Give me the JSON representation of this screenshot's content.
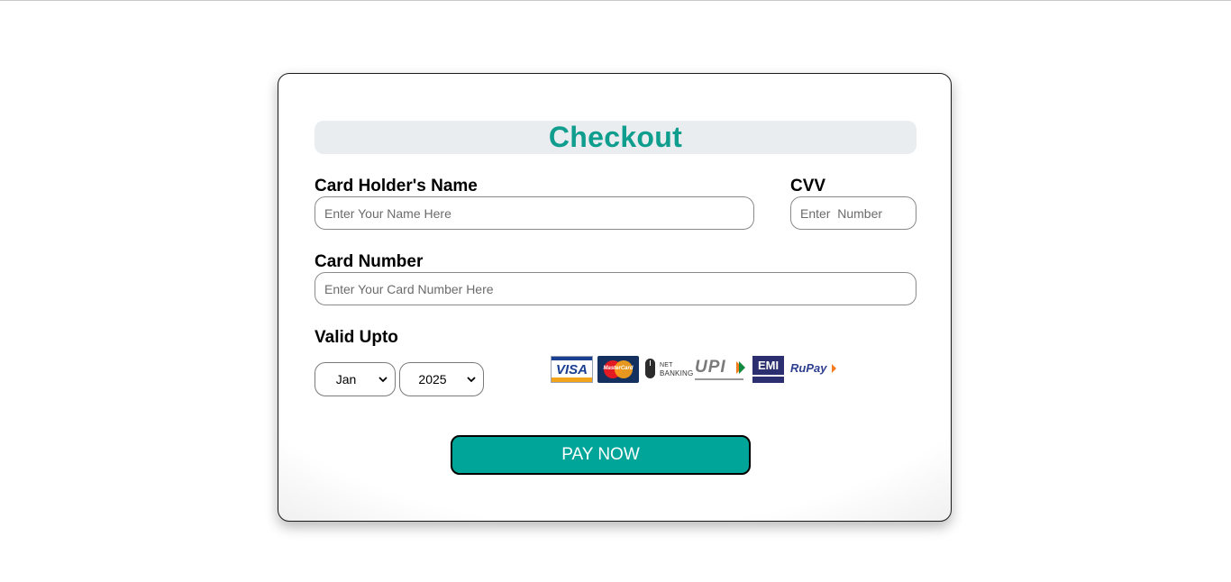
{
  "checkout": {
    "title": "Checkout",
    "card_holder": {
      "label": "Card Holder's Name",
      "placeholder": "Enter Your Name Here",
      "value": ""
    },
    "cvv": {
      "label": "CVV",
      "placeholder": "Enter  Number",
      "value": ""
    },
    "card_number": {
      "label": "Card Number",
      "placeholder": "Enter Your Card Number Here",
      "value": ""
    },
    "valid_upto": {
      "label": "Valid Upto",
      "month": "Jan",
      "year": "2025"
    },
    "payment_logos": {
      "visa": "VISA",
      "mastercard": "MasterCard",
      "netbanking_line1": "NET",
      "netbanking_line2": "BANKING",
      "upi": "UPI",
      "emi": "EMI",
      "rupay": "RuPay"
    },
    "pay_button": "PAY NOW"
  },
  "colors": {
    "accent": "#0f9d8e",
    "button": "#00a59a",
    "title_bar": "#e9edf0"
  },
  "icons": {
    "select_arrow": "chevron-down-icon",
    "netbanking": "mouse-icon"
  }
}
